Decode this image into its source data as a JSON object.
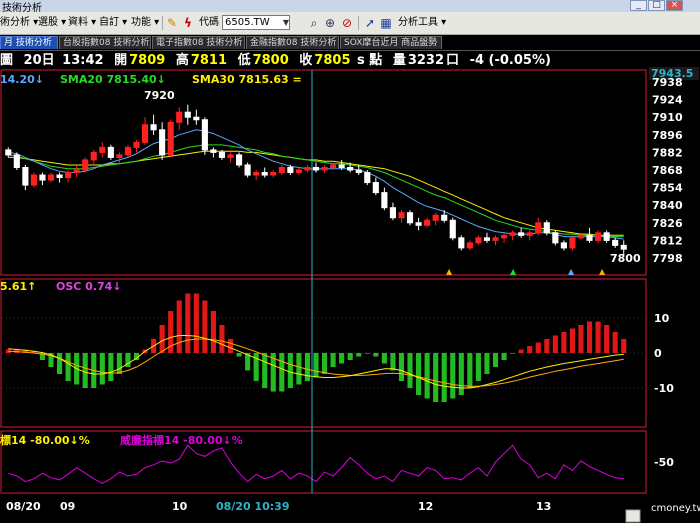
{
  "window": {
    "title": "技術分析",
    "btn_min": "_",
    "btn_max": "□",
    "btn_close": "×"
  },
  "toolbar": {
    "menus": [
      "術分析 ▾",
      "選股 ▾",
      "資料 ▾",
      "自訂 ▾",
      "功能 ▾"
    ],
    "code_label": "代碼",
    "stock_code": "6505.TW",
    "tools_label": "分析工具 ▾"
  },
  "tabs": [
    "月 技術分析",
    "台股指數08 技術分析",
    "電子指數08 技術分析",
    "金融指數08 技術分析",
    "SOX摩台近月 商品盤勢"
  ],
  "quote": {
    "prefix": "圖",
    "date": "20日",
    "time": "13:42",
    "open_label": "開",
    "open": "7809",
    "high_label": "高",
    "high": "7811",
    "low_label": "低",
    "low": "7800",
    "close_label": "收",
    "close": "7805",
    "unit": "s 點",
    "volume_label": "量",
    "volume": "3232",
    "volume_unit": "口",
    "change": "-4 (-0.05%)"
  },
  "legends": {
    "sma_a": "14.20↓",
    "sma20": "SMA20 7815.40↓",
    "sma30": "SMA30 7815.63 =",
    "macd_a": "5.61↑",
    "osc": "OSC 0.74↓",
    "wr_a": "標14 -80.00↓%",
    "wr_b": "威廉指標14 -80.00↓%"
  },
  "annotations": {
    "peak": "7920",
    "last": "7800",
    "current_price": "7943.5",
    "cursor_time": "08/20 10:39"
  },
  "x_labels": [
    "08/20",
    "09",
    "10",
    "12",
    "13"
  ],
  "watermark": "cmoney.tw",
  "colors": {
    "up": "#ff2020",
    "down": "#22cc22",
    "sma_a": "#5aa8ff",
    "sma20": "#22dd22",
    "sma30": "#ffee00",
    "osc": "#dd00dd",
    "panel": "#d11d38",
    "cursor": "#2fb3c9"
  },
  "chart_data": [
    {
      "type": "candlestick",
      "y_ticks": [
        7798,
        7812,
        7826,
        7840,
        7854,
        7868,
        7882,
        7896,
        7910,
        7924,
        7938
      ],
      "ylim": [
        7790,
        7946
      ],
      "candles": [
        [
          7884,
          7886,
          7878,
          7880
        ],
        [
          7880,
          7882,
          7868,
          7870
        ],
        [
          7870,
          7872,
          7852,
          7856
        ],
        [
          7856,
          7866,
          7854,
          7864
        ],
        [
          7864,
          7866,
          7856,
          7860
        ],
        [
          7860,
          7866,
          7858,
          7864
        ],
        [
          7864,
          7866,
          7858,
          7862
        ],
        [
          7862,
          7868,
          7858,
          7866
        ],
        [
          7866,
          7872,
          7862,
          7868
        ],
        [
          7868,
          7878,
          7866,
          7876
        ],
        [
          7876,
          7884,
          7872,
          7882
        ],
        [
          7882,
          7890,
          7878,
          7886
        ],
        [
          7886,
          7888,
          7876,
          7878
        ],
        [
          7878,
          7882,
          7872,
          7880
        ],
        [
          7880,
          7888,
          7878,
          7886
        ],
        [
          7886,
          7892,
          7882,
          7890
        ],
        [
          7890,
          7910,
          7888,
          7904
        ],
        [
          7904,
          7912,
          7896,
          7900
        ],
        [
          7900,
          7906,
          7876,
          7880
        ],
        [
          7880,
          7908,
          7878,
          7906
        ],
        [
          7906,
          7918,
          7900,
          7914
        ],
        [
          7914,
          7920,
          7904,
          7910
        ],
        [
          7910,
          7916,
          7904,
          7908
        ],
        [
          7908,
          7910,
          7880,
          7884
        ],
        [
          7884,
          7886,
          7878,
          7882
        ],
        [
          7882,
          7884,
          7876,
          7878
        ],
        [
          7878,
          7882,
          7874,
          7880
        ],
        [
          7880,
          7882,
          7870,
          7872
        ],
        [
          7872,
          7874,
          7862,
          7864
        ],
        [
          7864,
          7868,
          7860,
          7866
        ],
        [
          7866,
          7870,
          7862,
          7864
        ],
        [
          7864,
          7868,
          7862,
          7866
        ],
        [
          7866,
          7872,
          7864,
          7870
        ],
        [
          7870,
          7872,
          7864,
          7866
        ],
        [
          7866,
          7870,
          7864,
          7868
        ],
        [
          7868,
          7872,
          7866,
          7870
        ],
        [
          7870,
          7874,
          7866,
          7868
        ],
        [
          7868,
          7872,
          7866,
          7870
        ],
        [
          7870,
          7874,
          7868,
          7872
        ],
        [
          7872,
          7876,
          7868,
          7870
        ],
        [
          7870,
          7874,
          7866,
          7868
        ],
        [
          7868,
          7872,
          7864,
          7866
        ],
        [
          7866,
          7868,
          7856,
          7858
        ],
        [
          7858,
          7862,
          7848,
          7850
        ],
        [
          7850,
          7854,
          7836,
          7838
        ],
        [
          7838,
          7842,
          7828,
          7830
        ],
        [
          7830,
          7836,
          7826,
          7834
        ],
        [
          7834,
          7836,
          7824,
          7826
        ],
        [
          7826,
          7830,
          7820,
          7824
        ],
        [
          7824,
          7830,
          7822,
          7828
        ],
        [
          7828,
          7834,
          7824,
          7832
        ],
        [
          7832,
          7836,
          7826,
          7828
        ],
        [
          7828,
          7830,
          7812,
          7814
        ],
        [
          7814,
          7816,
          7804,
          7806
        ],
        [
          7806,
          7812,
          7804,
          7810
        ],
        [
          7810,
          7816,
          7808,
          7814
        ],
        [
          7814,
          7818,
          7810,
          7812
        ],
        [
          7812,
          7816,
          7808,
          7814
        ],
        [
          7814,
          7818,
          7810,
          7816
        ],
        [
          7816,
          7820,
          7812,
          7818
        ],
        [
          7818,
          7822,
          7814,
          7816
        ],
        [
          7816,
          7820,
          7812,
          7818
        ],
        [
          7818,
          7830,
          7816,
          7826
        ],
        [
          7826,
          7828,
          7816,
          7818
        ],
        [
          7818,
          7820,
          7808,
          7810
        ],
        [
          7810,
          7812,
          7804,
          7806
        ],
        [
          7806,
          7816,
          7804,
          7814
        ],
        [
          7814,
          7818,
          7812,
          7816
        ],
        [
          7816,
          7822,
          7810,
          7812
        ],
        [
          7812,
          7820,
          7810,
          7818
        ],
        [
          7818,
          7820,
          7810,
          7812
        ],
        [
          7812,
          7814,
          7806,
          7808
        ],
        [
          7808,
          7812,
          7800,
          7805
        ]
      ],
      "sma_a": [
        7882,
        7881,
        7878,
        7875,
        7872,
        7869,
        7867,
        7866,
        7866,
        7867,
        7869,
        7872,
        7874,
        7876,
        7878,
        7881,
        7885,
        7889,
        7891,
        7893,
        7896,
        7898,
        7900,
        7899,
        7897,
        7894,
        7891,
        7888,
        7884,
        7881,
        7878,
        7875,
        7873,
        7871,
        7870,
        7869,
        7869,
        7869,
        7869,
        7869,
        7869,
        7868,
        7866,
        7863,
        7859,
        7854,
        7850,
        7846,
        7842,
        7839,
        7837,
        7835,
        7832,
        7829,
        7826,
        7823,
        7821,
        7819,
        7818,
        7817,
        7817,
        7817,
        7818,
        7818,
        7817,
        7815,
        7815,
        7815,
        7815,
        7815,
        7815,
        7814,
        7813
      ],
      "sma20": [
        7880,
        7879,
        7877,
        7875,
        7873,
        7871,
        7870,
        7869,
        7869,
        7869,
        7870,
        7871,
        7872,
        7873,
        7874,
        7875,
        7877,
        7879,
        7880,
        7882,
        7884,
        7886,
        7887,
        7888,
        7888,
        7888,
        7887,
        7886,
        7885,
        7884,
        7882,
        7881,
        7879,
        7878,
        7877,
        7876,
        7875,
        7874,
        7873,
        7873,
        7872,
        7871,
        7870,
        7868,
        7866,
        7863,
        7860,
        7857,
        7854,
        7851,
        7848,
        7846,
        7843,
        7840,
        7837,
        7834,
        7831,
        7828,
        7826,
        7824,
        7822,
        7821,
        7820,
        7819,
        7818,
        7817,
        7817,
        7816,
        7816,
        7816,
        7815,
        7815,
        7815
      ],
      "sma30": [
        7878,
        7878,
        7877,
        7876,
        7875,
        7874,
        7873,
        7872,
        7872,
        7872,
        7872,
        7872,
        7873,
        7873,
        7874,
        7875,
        7876,
        7877,
        7878,
        7879,
        7880,
        7881,
        7882,
        7883,
        7883,
        7883,
        7883,
        7883,
        7882,
        7882,
        7881,
        7880,
        7879,
        7878,
        7877,
        7876,
        7876,
        7875,
        7875,
        7874,
        7873,
        7872,
        7871,
        7870,
        7869,
        7867,
        7865,
        7863,
        7860,
        7857,
        7854,
        7851,
        7848,
        7845,
        7842,
        7839,
        7836,
        7833,
        7830,
        7828,
        7826,
        7824,
        7822,
        7821,
        7820,
        7819,
        7818,
        7817,
        7817,
        7816,
        7816,
        7816,
        7816
      ]
    },
    {
      "type": "bar",
      "y_ticks": [
        10,
        0,
        -10
      ],
      "ylim": [
        -20,
        20
      ],
      "osc": [
        1,
        1,
        1,
        0.5,
        -2,
        -4,
        -6,
        -8,
        -9,
        -10,
        -10,
        -9,
        -8,
        -6,
        -4,
        -2,
        1,
        4,
        8,
        12,
        15,
        17,
        17,
        15,
        12,
        8,
        4,
        -1,
        -5,
        -8,
        -10,
        -11,
        -11,
        -10,
        -9,
        -8,
        -7,
        -6,
        -4,
        -3,
        -2,
        -1,
        0,
        -1,
        -3,
        -5,
        -8,
        -10,
        -12,
        -13,
        -14,
        -14,
        -13,
        -12,
        -10,
        -8,
        -6,
        -4,
        -2,
        0,
        1,
        2,
        3,
        4,
        5,
        6,
        7,
        8,
        9,
        9,
        8,
        6,
        4
      ],
      "macd": [
        1.2,
        1,
        0.8,
        0.5,
        0.1,
        -0.5,
        -1.5,
        -3,
        -4.5,
        -5.5,
        -6,
        -6,
        -5.5,
        -4.5,
        -3,
        -1.5,
        0.5,
        2,
        3.5,
        4.5,
        5,
        5,
        4.8,
        4.2,
        3.5,
        2.5,
        1.5,
        0.5,
        -0.5,
        -1.5,
        -2.5,
        -3.5,
        -4.5,
        -5.5,
        -6,
        -6.5,
        -6.8,
        -7,
        -7,
        -6.8,
        -6.5,
        -6,
        -5.5,
        -5,
        -4.5,
        -4.5,
        -5,
        -6,
        -7,
        -8,
        -9,
        -9.5,
        -9.8,
        -10,
        -10,
        -9.6,
        -9,
        -8.4,
        -7.6,
        -6.8,
        -6,
        -5.2,
        -4.6,
        -4,
        -3.5,
        -3,
        -2.6,
        -2.2,
        -1.8,
        -1.4,
        -1,
        -0.6,
        -0.4
      ],
      "signal": [
        0.5,
        0.4,
        0.2,
        0,
        -0.3,
        -0.8,
        -1.5,
        -2.5,
        -3.5,
        -4.3,
        -5,
        -5.5,
        -5.8,
        -5.6,
        -5,
        -4,
        -2.6,
        -1,
        0.5,
        2,
        3,
        3.7,
        4,
        4,
        3.8,
        3.4,
        2.8,
        2,
        1.2,
        0.3,
        -0.6,
        -1.5,
        -2.4,
        -3.3,
        -4,
        -4.7,
        -5.2,
        -5.6,
        -6,
        -6.2,
        -6.4,
        -6.4,
        -6.3,
        -6.1,
        -5.9,
        -5.8,
        -5.9,
        -6.3,
        -6.8,
        -7.4,
        -8,
        -8.5,
        -9,
        -9.3,
        -9.5,
        -9.5,
        -9.3,
        -9,
        -8.6,
        -8.1,
        -7.5,
        -6.9,
        -6.3,
        -5.8,
        -5.2,
        -4.8,
        -4.3,
        -3.8,
        -3.4,
        -3,
        -2.6,
        -2.2,
        -1.8
      ]
    },
    {
      "type": "line",
      "name": "威廉指標14",
      "y_ticks": [
        -50
      ],
      "ylim": [
        -100,
        0
      ],
      "values": [
        -70,
        -75,
        -85,
        -80,
        -70,
        -78,
        -82,
        -72,
        -60,
        -70,
        -80,
        -88,
        -80,
        -68,
        -75,
        -72,
        -60,
        -55,
        -48,
        -52,
        -45,
        -20,
        -35,
        -40,
        -30,
        -25,
        -50,
        -70,
        -85,
        -72,
        -80,
        -75,
        -65,
        -80,
        -70,
        -75,
        -85,
        -68,
        -75,
        -60,
        -42,
        -55,
        -70,
        -80,
        -75,
        -85,
        -65,
        -70,
        -75,
        -60,
        -65,
        -80,
        -78,
        -82,
        -70,
        -60,
        -75,
        -50,
        -35,
        -20,
        -45,
        -55,
        -78,
        -70,
        -80,
        -55,
        -65,
        -48,
        -58,
        -65,
        -72,
        -78,
        -80
      ]
    }
  ]
}
